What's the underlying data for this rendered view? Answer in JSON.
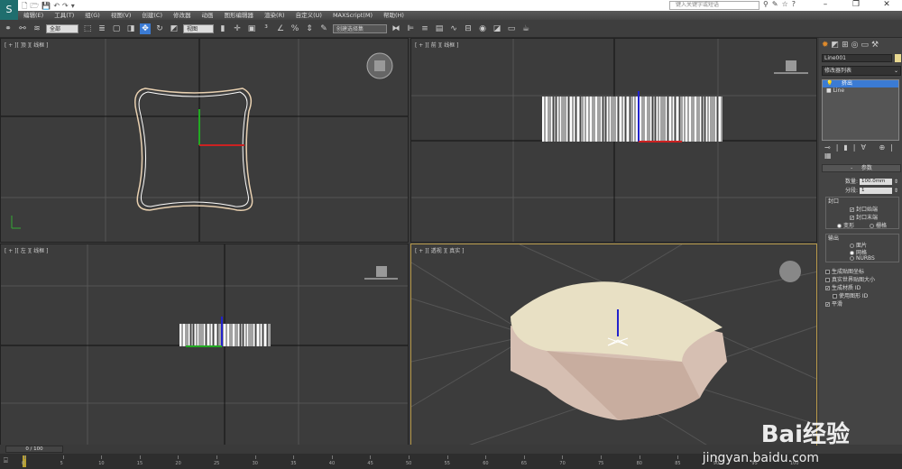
{
  "title_bar": {
    "app_icon": "3ds-max-logo",
    "search_placeholder": "键入关键字或短语",
    "window_controls": [
      "–",
      "❐",
      "✕"
    ]
  },
  "menu": [
    "编辑(E)",
    "工具(T)",
    "组(G)",
    "视图(V)",
    "创建(C)",
    "修改器",
    "动画",
    "图形编辑器",
    "渲染(R)",
    "自定义(U)",
    "MAXScript(M)",
    "帮助(H)"
  ],
  "toolbar": {
    "filter": "全部",
    "ref_coord": "视图",
    "selection_set": "创建选择集"
  },
  "viewports": [
    {
      "label": "[ + ][ 顶 ][ 线框 ]"
    },
    {
      "label": "[ + ][ 前 ][ 线框 ]"
    },
    {
      "label": "[ + ][ 左 ][ 线框 ]"
    },
    {
      "label": "[ + ][ 透视 ][ 真实 ]"
    }
  ],
  "command_panel": {
    "object_name": "Line001",
    "object_color": "#e8d890",
    "modifier_list": "修改器列表",
    "stack": [
      {
        "label": "挤出",
        "selected": true
      },
      {
        "label": "Line",
        "selected": false
      }
    ],
    "rollout_title": "参数",
    "amount_label": "数量:",
    "amount_value": "100.0mm",
    "segments_label": "分段:",
    "segments_value": "1",
    "capping_title": "封口",
    "cap_start": {
      "label": "封口始端",
      "checked": true
    },
    "cap_end": {
      "label": "封口末端",
      "checked": true
    },
    "morph": {
      "label": "变形",
      "selected": true
    },
    "grid": {
      "label": "栅格",
      "selected": false
    },
    "output_title": "输出",
    "output_options": [
      {
        "label": "面片",
        "selected": false
      },
      {
        "label": "网格",
        "selected": true
      },
      {
        "label": "NURBS",
        "selected": false
      }
    ],
    "checks": [
      {
        "label": "生成贴图坐标",
        "checked": false
      },
      {
        "label": "真实世界贴图大小",
        "checked": false
      },
      {
        "label": "生成材质 ID",
        "checked": true
      },
      {
        "label": "使用图形 ID",
        "checked": false
      },
      {
        "label": "平滑",
        "checked": true
      }
    ]
  },
  "timeline": {
    "frame_display": "0 / 100",
    "current_frame": 0,
    "ticks": [
      "0",
      "5",
      "10",
      "15",
      "20",
      "25",
      "30",
      "35",
      "40",
      "45",
      "50",
      "55",
      "60",
      "65",
      "70",
      "75",
      "80",
      "85",
      "90",
      "95",
      "100"
    ]
  },
  "watermark": {
    "text": "Bai经验",
    "url_text": "jingyan.baidu.com"
  }
}
